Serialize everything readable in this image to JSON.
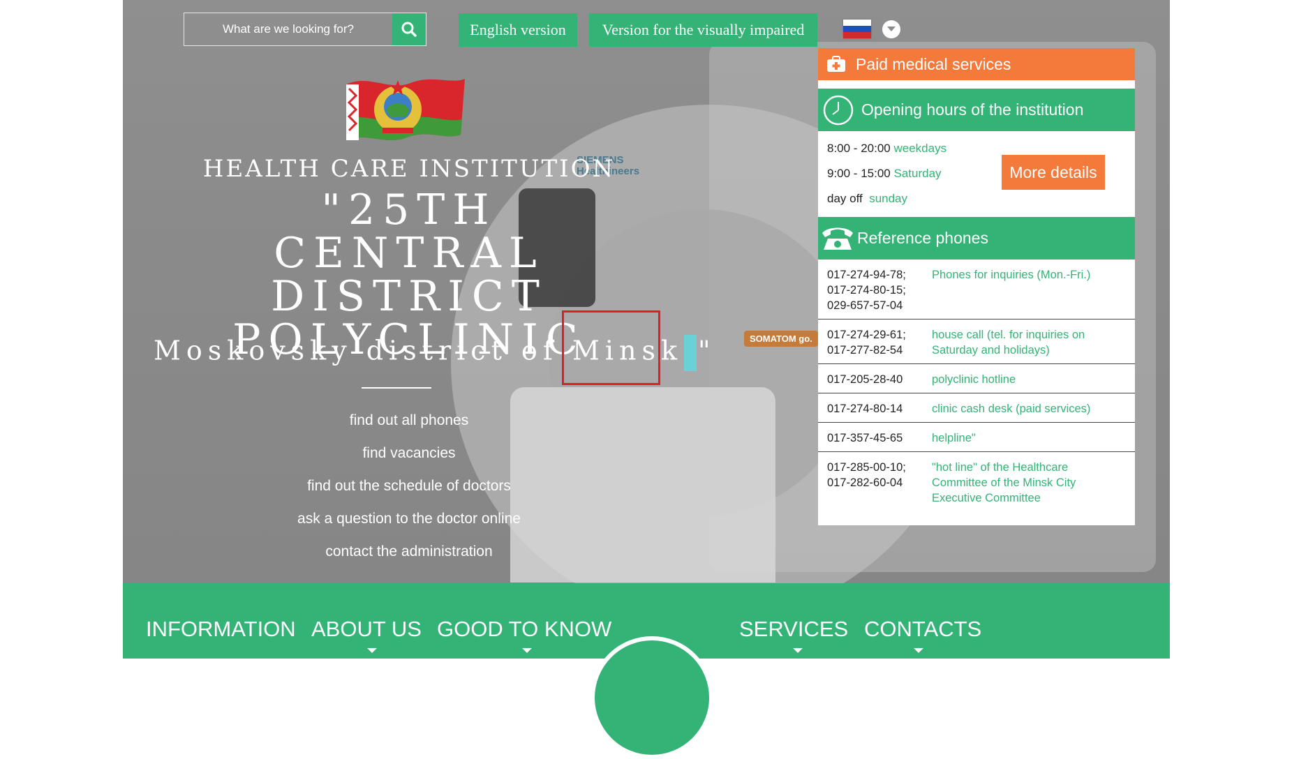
{
  "search": {
    "placeholder": "What are we looking for?"
  },
  "top_buttons": {
    "english": "English version",
    "impaired": "Version for the visually impaired"
  },
  "flag_colors": [
    "#ffffff",
    "#1f4fbf",
    "#d62a2a"
  ],
  "hero": {
    "institution": "HEALTH CARE INSTITUTION",
    "name": "\"25TH CENTRAL DISTRICT POLYCLINIC",
    "district": "Moskovsky district of Minsk",
    "quote_close": "\"",
    "links": [
      "find out all phones",
      "find vacancies",
      "find out the schedule of doctors",
      "ask a question to the doctor online",
      "contact the administration"
    ]
  },
  "scanner": {
    "brand_line1": "SIEMENS",
    "brand_line2": "Healthineers",
    "model": "SOMATOM go."
  },
  "panel": {
    "paid_services": "Paid medical services",
    "hours_title": "Opening hours of the institution",
    "hours": [
      {
        "time": "8:00 - 20:00",
        "day": "weekdays"
      },
      {
        "time": "9:00 - 15:00",
        "day": "Saturday"
      },
      {
        "time": "day off",
        "day": "sunday"
      }
    ],
    "more_details": "More details",
    "phones_title": "Reference phones",
    "phones": [
      {
        "numbers": "017-274-94-78;\n017-274-80-15;\n029-657-57-04",
        "desc": "Phones for inquiries (Mon.-Fri.)"
      },
      {
        "numbers": "017-274-29-61;\n017-277-82-54",
        "desc": "house call (tel. for inquiries on Saturday and holidays)"
      },
      {
        "numbers": "017-205-28-40",
        "desc": "polyclinic hotline"
      },
      {
        "numbers": "017-274-80-14",
        "desc": "clinic cash desk (paid services)"
      },
      {
        "numbers": "017-357-45-65",
        "desc": "helpline\""
      },
      {
        "numbers": "017-285-00-10;\n017-282-60-04",
        "desc": "\"hot line\" of the Healthcare Committee of the Minsk City Executive Committee"
      }
    ]
  },
  "nav": {
    "information": "INFORMATION",
    "about": "ABOUT US",
    "good_to_know": "GOOD TO KNOW",
    "services": "SERVICES",
    "contacts": "CONTACTS"
  },
  "colors": {
    "green": "#33b376",
    "orange": "#f47a3c",
    "highlight": "#e01f25"
  }
}
